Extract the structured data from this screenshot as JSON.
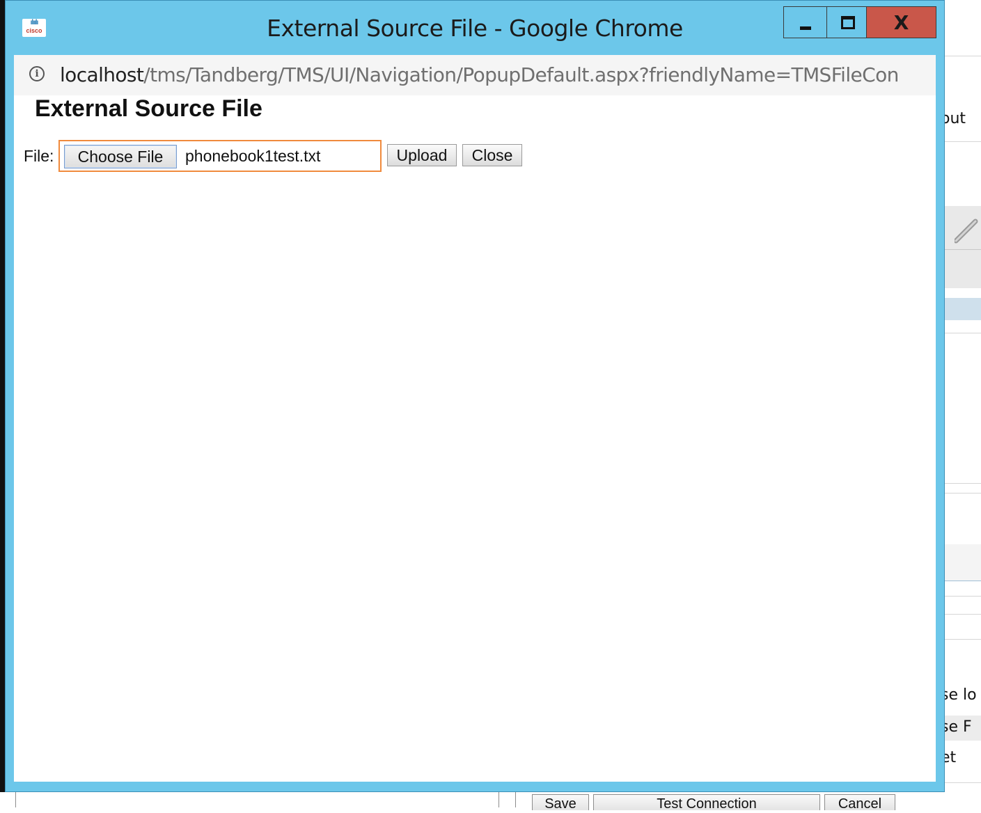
{
  "background": {
    "right_fragments": [
      "out",
      "se lo",
      "se F",
      "et"
    ],
    "bottom_buttons": {
      "save": "Save",
      "test_connection": "Test Connection",
      "cancel": "Cancel"
    }
  },
  "window": {
    "title": "External Source File - Google Chrome",
    "icon": "cisco-logo",
    "controls": [
      "minimize-icon",
      "maximize-icon",
      "close-icon"
    ],
    "close_label": "X",
    "colors": {
      "titlebar": "#6cc7ea",
      "close": "#c9574a"
    }
  },
  "address_bar": {
    "host": "localhost",
    "path": "/tms/Tandberg/TMS/UI/Navigation/PopupDefault.aspx?friendlyName=TMSFileCon"
  },
  "page": {
    "title": "External Source File",
    "file_label": "File:",
    "choose_file_label": "Choose File",
    "file_name": "phonebook1test.txt",
    "upload_label": "Upload",
    "close_label": "Close",
    "focus_color": "#f08a3c"
  }
}
